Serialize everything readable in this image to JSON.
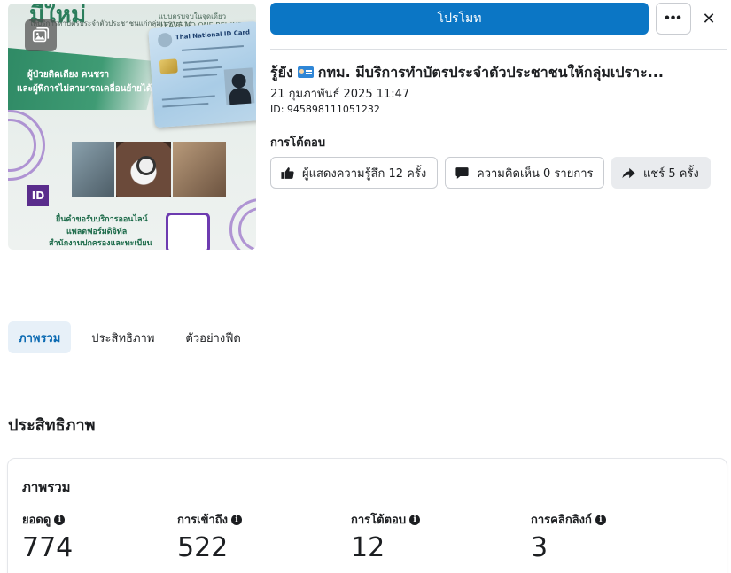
{
  "thumbnail": {
    "headline": "มีใหม่",
    "subtitle": "ให้บริการทำบัตรประจำตัวประชาชนแก่กลุ่มเปราะบาง",
    "slogan_th": "แบบครบจบในจุดเดียว",
    "slogan_en": "LEAVE NO ONE BEHIND",
    "banner_line1": "ผู้ป่วยติดเตียง คนชรา",
    "banner_line2": "และผู้พิการไม่สามารถเคลื่อนย้ายได้",
    "card_title": "Thai National ID Card",
    "id_logo": "ID",
    "footer_line1": "ยื่นคำขอรับบริการออนไลน์",
    "footer_line2": "แพลตฟอร์มดิจิทัล",
    "footer_line3": "สำนักงานปกครองและทะเบียน"
  },
  "header": {
    "promote_label": "โปรโมท",
    "more_label": "•••",
    "close_label": "✕"
  },
  "post": {
    "title_prefix": "รู้ยัง",
    "title_rest": "กทม. มีบริการทำบัตรประจำตัวประชาชนให้กลุ่มเปราะ...",
    "date": "21 กุมภาพันธ์ 2025 11:47",
    "id": "ID: 945898111051232"
  },
  "engagement": {
    "heading": "การโต้ตอบ",
    "reactions_label": "ผู้แสดงความรู้สึก 12 ครั้ง",
    "comments_label": "ความคิดเห็น 0 รายการ",
    "shares_label": "แชร์ 5 ครั้ง"
  },
  "tabs": [
    {
      "label": "ภาพรวม",
      "active": true
    },
    {
      "label": "ประสิทธิภาพ",
      "active": false
    },
    {
      "label": "ตัวอย่างฟีด",
      "active": false
    }
  ],
  "performance": {
    "heading": "ประสิทธิภาพ",
    "card_heading": "ภาพรวม",
    "metrics": [
      {
        "label": "ยอดดู",
        "value": "774"
      },
      {
        "label": "การเข้าถึง",
        "value": "522"
      },
      {
        "label": "การโต้ตอบ",
        "value": "12"
      },
      {
        "label": "การคลิกลิงก์",
        "value": "3"
      }
    ]
  },
  "colors": {
    "primary": "#0b76c5",
    "active_tab_bg": "#e7f0f8",
    "active_tab_text": "#0b6ab2"
  }
}
